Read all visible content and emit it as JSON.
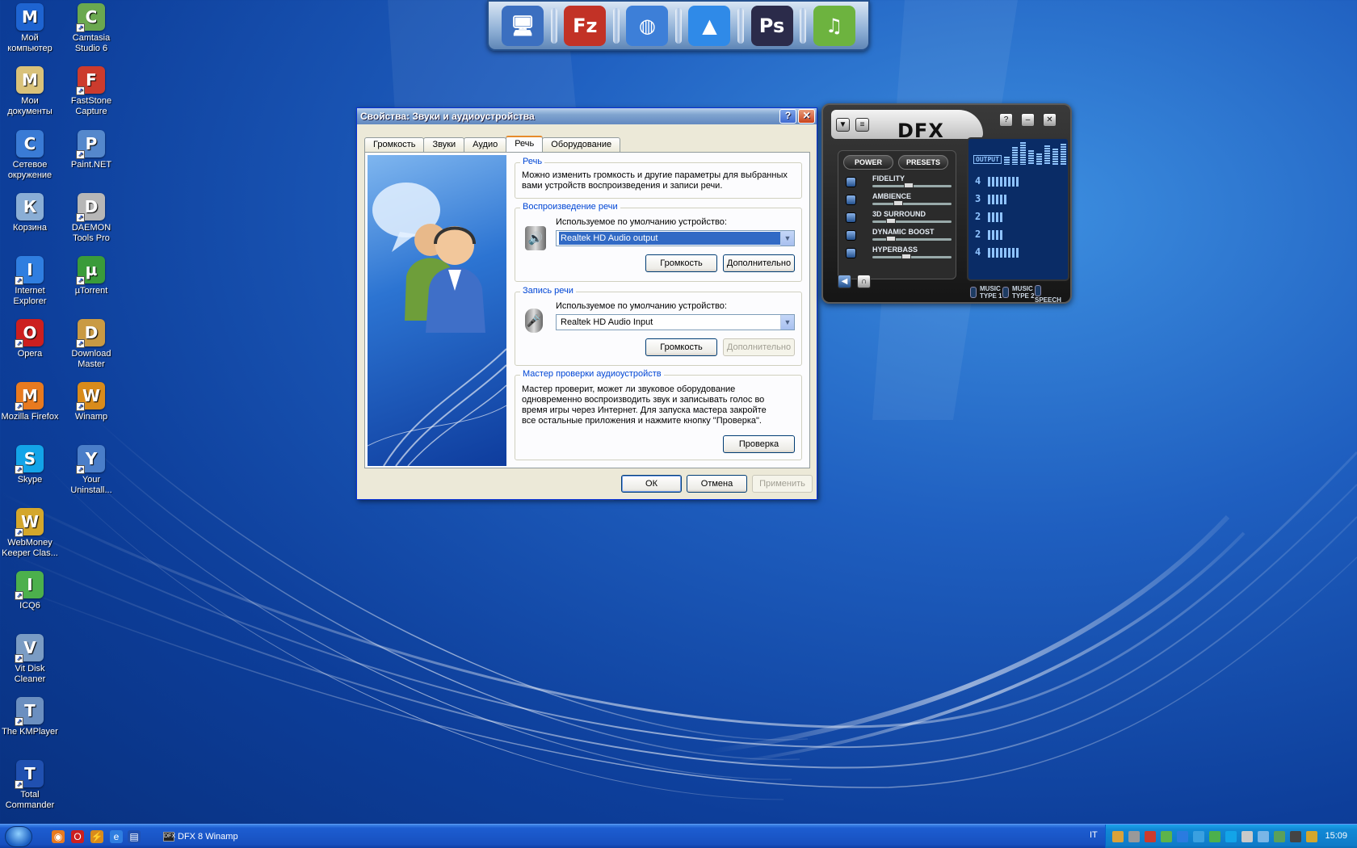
{
  "desktop": {
    "icons": [
      {
        "label": "Мой компьютер",
        "icon": "my-computer-icon",
        "color": "#1e64d1"
      },
      {
        "label": "Camtasia Studio 6",
        "icon": "camtasia-icon",
        "color": "#6aa84f"
      },
      {
        "label": "Мои документы",
        "icon": "my-documents-icon",
        "color": "#d9c27a"
      },
      {
        "label": "FastStone Capture",
        "icon": "faststone-icon",
        "color": "#cc3b2d"
      },
      {
        "label": "Сетевое окружение",
        "icon": "network-icon",
        "color": "#3a7bd5"
      },
      {
        "label": "Paint.NET",
        "icon": "paint-net-icon",
        "color": "#5588cc"
      },
      {
        "label": "Корзина",
        "icon": "recycle-bin-icon",
        "color": "#8aaed6"
      },
      {
        "label": "DAEMON Tools Pro",
        "icon": "daemon-tools-icon",
        "color": "#b7b7b7"
      },
      {
        "label": "Internet Explorer",
        "icon": "internet-explorer-icon",
        "color": "#2f7ee0"
      },
      {
        "label": "µTorrent",
        "icon": "utorrent-icon",
        "color": "#3a9b3a"
      },
      {
        "label": "Opera",
        "icon": "opera-icon",
        "color": "#cc1f1f"
      },
      {
        "label": "Download Master",
        "icon": "download-master-icon",
        "color": "#c99a44"
      },
      {
        "label": "Mozilla Firefox",
        "icon": "firefox-icon",
        "color": "#e87a1f"
      },
      {
        "label": "Winamp",
        "icon": "winamp-icon",
        "color": "#d98b1b"
      },
      {
        "label": "Skype",
        "icon": "skype-icon",
        "color": "#13a4e8"
      },
      {
        "label": "Your Uninstall...",
        "icon": "your-uninstaller-icon",
        "color": "#4a7ec9"
      },
      {
        "label": "WebMoney Keeper Clas...",
        "icon": "webmoney-icon",
        "color": "#d4a72c"
      },
      {
        "label": "ICQ6",
        "icon": "icq-icon",
        "color": "#4cb04c"
      },
      {
        "label": "Vit Disk Cleaner",
        "icon": "disk-cleaner-icon",
        "color": "#7a9cc4"
      },
      {
        "label": "The KMPlayer",
        "icon": "kmplayer-icon",
        "color": "#6b8fc0"
      },
      {
        "label": "Total Commander",
        "icon": "total-commander-icon",
        "color": "#2050b0"
      }
    ]
  },
  "dock": {
    "items": [
      {
        "icon": "monitor-icon",
        "glyph": "🖥",
        "color": "#3b6fc0"
      },
      {
        "icon": "filezilla-icon",
        "glyph": "Fz",
        "color": "#c23226"
      },
      {
        "icon": "globe-icon",
        "glyph": "◍",
        "color": "#3d7fd8"
      },
      {
        "icon": "up-arrow-icon",
        "glyph": "▲",
        "color": "#2f8ae8"
      },
      {
        "icon": "photoshop-icon",
        "glyph": "Ps",
        "color": "#2b2b4a"
      },
      {
        "icon": "music-note-icon",
        "glyph": "♫",
        "color": "#6db33f"
      }
    ]
  },
  "dialog": {
    "title": "Свойства: Звуки и аудиоустройства",
    "tabs": [
      "Громкость",
      "Звуки",
      "Аудио",
      "Речь",
      "Оборудование"
    ],
    "active_tab": "Речь",
    "speech": {
      "legend": "Речь",
      "text": "Можно изменить громкость и другие параметры для выбранных вами устройств воспроизведения и записи речи."
    },
    "playback": {
      "legend": "Воспроизведение речи",
      "label": "Используемое по умолчанию устройство:",
      "device": "Realtek HD Audio output",
      "volume_btn": "Громкость",
      "advanced_btn": "Дополнительно"
    },
    "recording": {
      "legend": "Запись речи",
      "label": "Используемое по умолчанию устройство:",
      "device": "Realtek HD Audio Input",
      "volume_btn": "Громкость",
      "advanced_btn": "Дополнительно"
    },
    "wizard": {
      "legend": "Мастер проверки аудиоустройств",
      "text": "Мастер проверит, может ли звуковое оборудование одновременно воспроизводить звук и записывать голос во время игры через Интернет. Для запуска мастера  закройте все остальные приложения и нажмите кнопку \"Проверка\".",
      "test_btn": "Проверка"
    },
    "ok": "ОК",
    "cancel": "Отмена",
    "apply": "Применить"
  },
  "dfx": {
    "logo": "DFX",
    "power": "POWER",
    "presets": "PRESETS",
    "sliders": [
      {
        "label": "FIDELITY",
        "level": 0.45,
        "lcd": "4"
      },
      {
        "label": "AMBIENCE",
        "level": 0.3,
        "lcd": "3"
      },
      {
        "label": "3D SURROUND",
        "level": 0.2,
        "lcd": "2"
      },
      {
        "label": "DYNAMIC BOOST",
        "level": 0.2,
        "lcd": "2"
      },
      {
        "label": "HYPERBASS",
        "level": 0.42,
        "lcd": "4"
      }
    ],
    "output_label": "OUTPUT",
    "modes": [
      {
        "line1": "MUSIC",
        "line2": "TYPE 1"
      },
      {
        "line1": "MUSIC",
        "line2": "TYPE 2"
      },
      {
        "line1": "SPEECH",
        "line2": ""
      }
    ]
  },
  "taskbar": {
    "task": "DFX 8 Winamp",
    "task_icon": "DFX",
    "lang": "IT",
    "clock": "15:09"
  }
}
